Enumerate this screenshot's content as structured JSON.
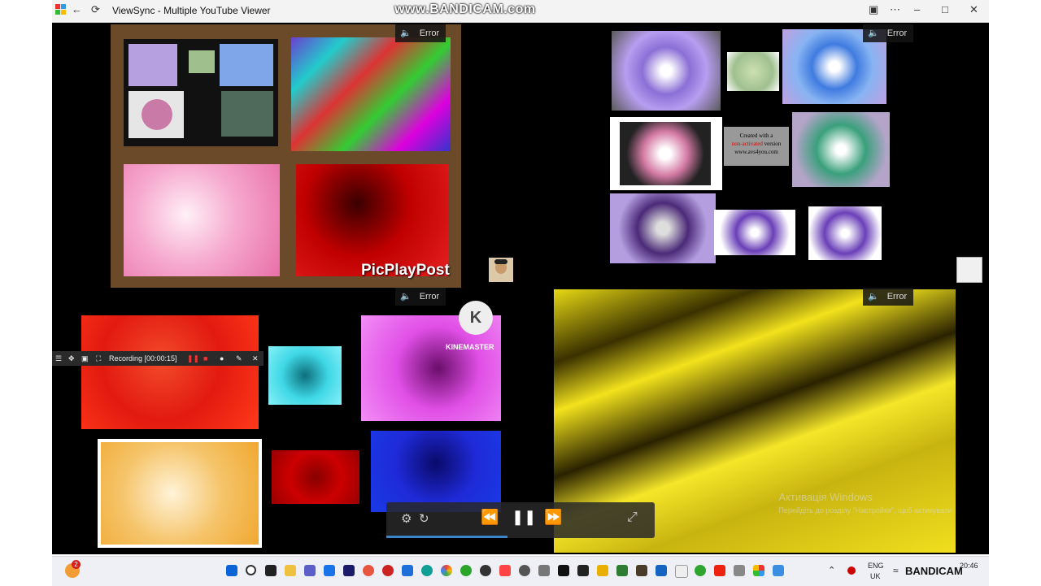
{
  "window": {
    "title": "ViewSync - Multiple YouTube Viewer",
    "watermark": "www.BANDICAM.com"
  },
  "panes": {
    "error_label": "Error",
    "pane1_overlay": "PicPlayPost",
    "pane2_overlay": {
      "line1": "Created with a",
      "line2": "non-activated",
      "line3": "version",
      "line4": "www.avs4you.com"
    },
    "pane3_overlay": "KINEMASTER"
  },
  "recorder": {
    "label": "Recording [00:00:15]"
  },
  "player": {
    "progress": 0.45
  },
  "activation": {
    "title": "Активація Windows",
    "subtitle": "Перейдіть до розділу \"Настройки\", щоб активувати"
  },
  "taskbar": {
    "notification_count": "2",
    "language_line1": "ENG",
    "language_line2": "UK",
    "tray_app": "BANDICAM",
    "time": "20:46"
  },
  "colors": {
    "titlebar": "#f3f3f3",
    "content_bg": "#000000",
    "taskbar": "#eef0f6",
    "progress": "#3b86c8"
  }
}
